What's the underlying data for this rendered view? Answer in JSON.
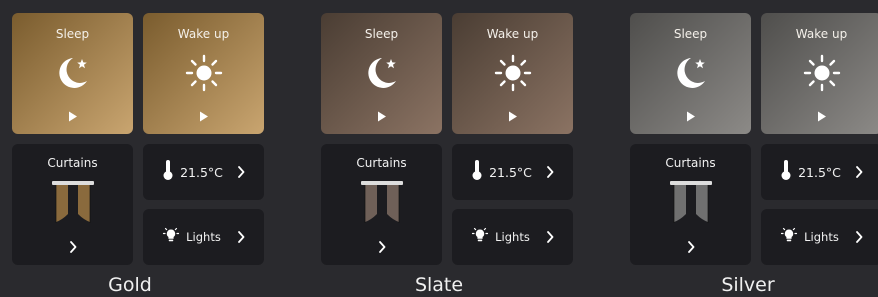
{
  "themes": [
    {
      "name": "Gold",
      "colors": {
        "gradient_from": "#7a5c2e",
        "gradient_to": "#c9a570",
        "curtain": "#8a6a3d"
      },
      "tiles": {
        "sleep": "Sleep",
        "wake": "Wake up",
        "curtains": "Curtains",
        "temperature": "21.5°C",
        "lights": "Lights"
      }
    },
    {
      "name": "Slate",
      "colors": {
        "gradient_from": "#4a3d33",
        "gradient_to": "#8b7363",
        "curtain": "#6f6058"
      },
      "tiles": {
        "sleep": "Sleep",
        "wake": "Wake up",
        "curtains": "Curtains",
        "temperature": "21.5°C",
        "lights": "Lights"
      }
    },
    {
      "name": "Silver",
      "colors": {
        "gradient_from": "#4f4e4c",
        "gradient_to": "#8c8a87",
        "curtain": "#707070"
      },
      "tiles": {
        "sleep": "Sleep",
        "wake": "Wake up",
        "curtains": "Curtains",
        "temperature": "21.5°C",
        "lights": "Lights"
      }
    }
  ],
  "icons": [
    "moon-star-icon",
    "sun-icon",
    "play-icon",
    "curtains-icon",
    "chevron-right-icon",
    "thermometer-icon",
    "bulb-icon"
  ]
}
